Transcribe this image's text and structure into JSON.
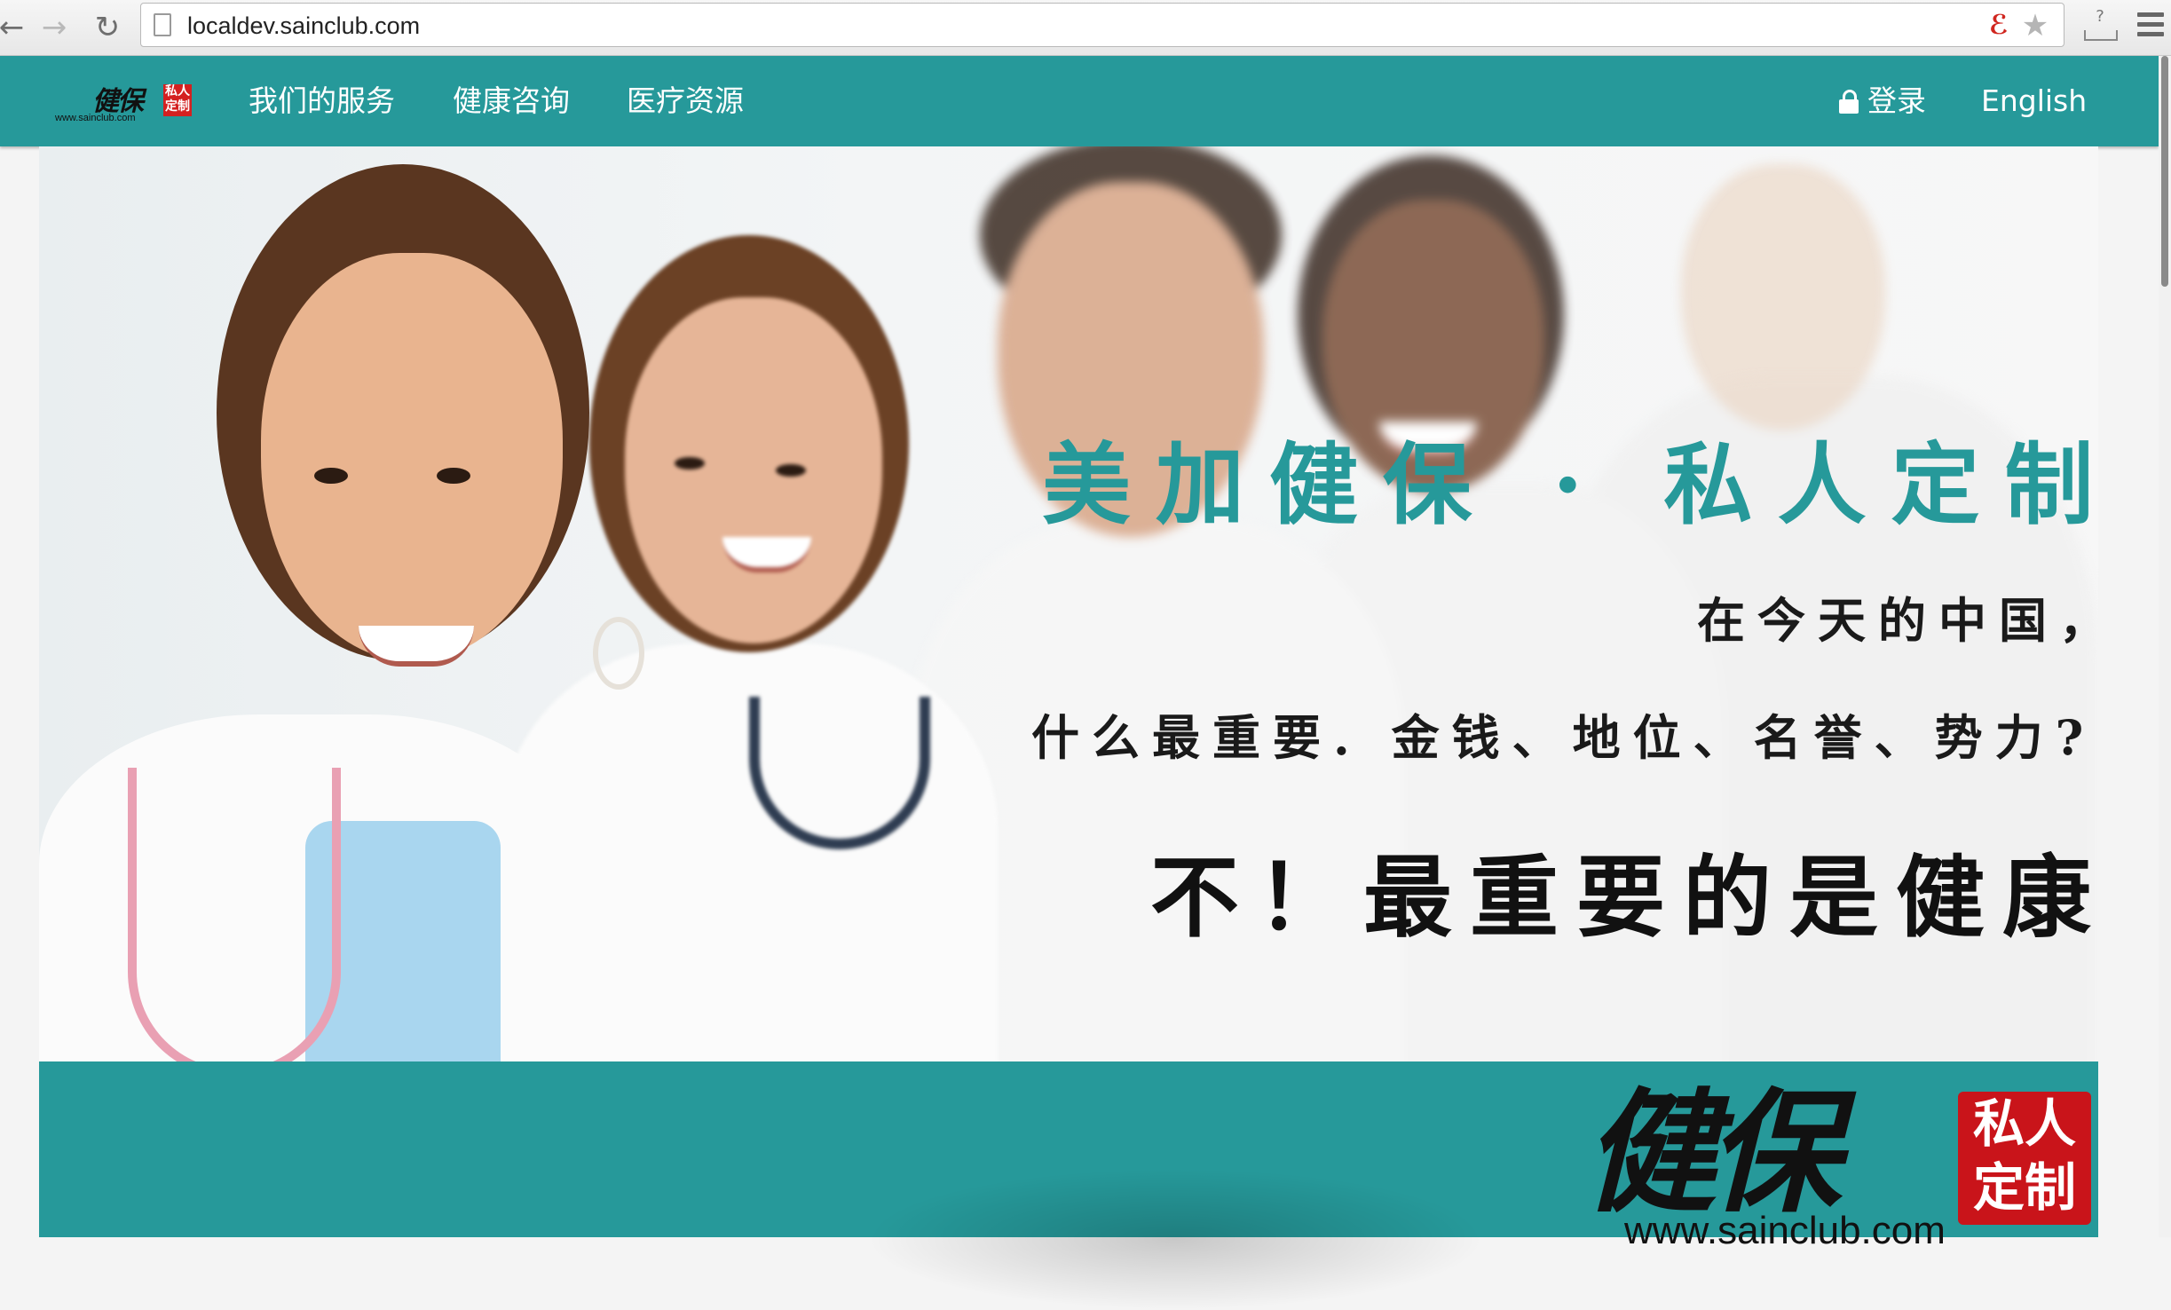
{
  "browser": {
    "back_icon": "←",
    "forward_icon": "→",
    "reload_icon": "↻",
    "url": "localdev.sainclub.com",
    "star_icon": "★",
    "ext_icon": "ℰ",
    "download_badge": "?"
  },
  "nav": {
    "logo_text": "健保",
    "logo_seal": "私人定制",
    "logo_url": "www.sainclub.com",
    "links": [
      "我们的服务",
      "健康咨询",
      "医疗资源"
    ],
    "login_label": "登录",
    "language_label": "English"
  },
  "hero": {
    "headline": "美加健保 · 私人定制",
    "line1": "在今天的中国，",
    "line2": "什么最重要. 金钱、地位、名誉、势力?",
    "line3": "不！最重要的是健康"
  },
  "band": {
    "logo_text": "健保",
    "logo_seal_top": "私人",
    "logo_seal_bottom": "定制",
    "logo_url": "www.sainclub.com"
  },
  "colors": {
    "brand_teal": "#26999a",
    "seal_red": "#c9141a"
  }
}
